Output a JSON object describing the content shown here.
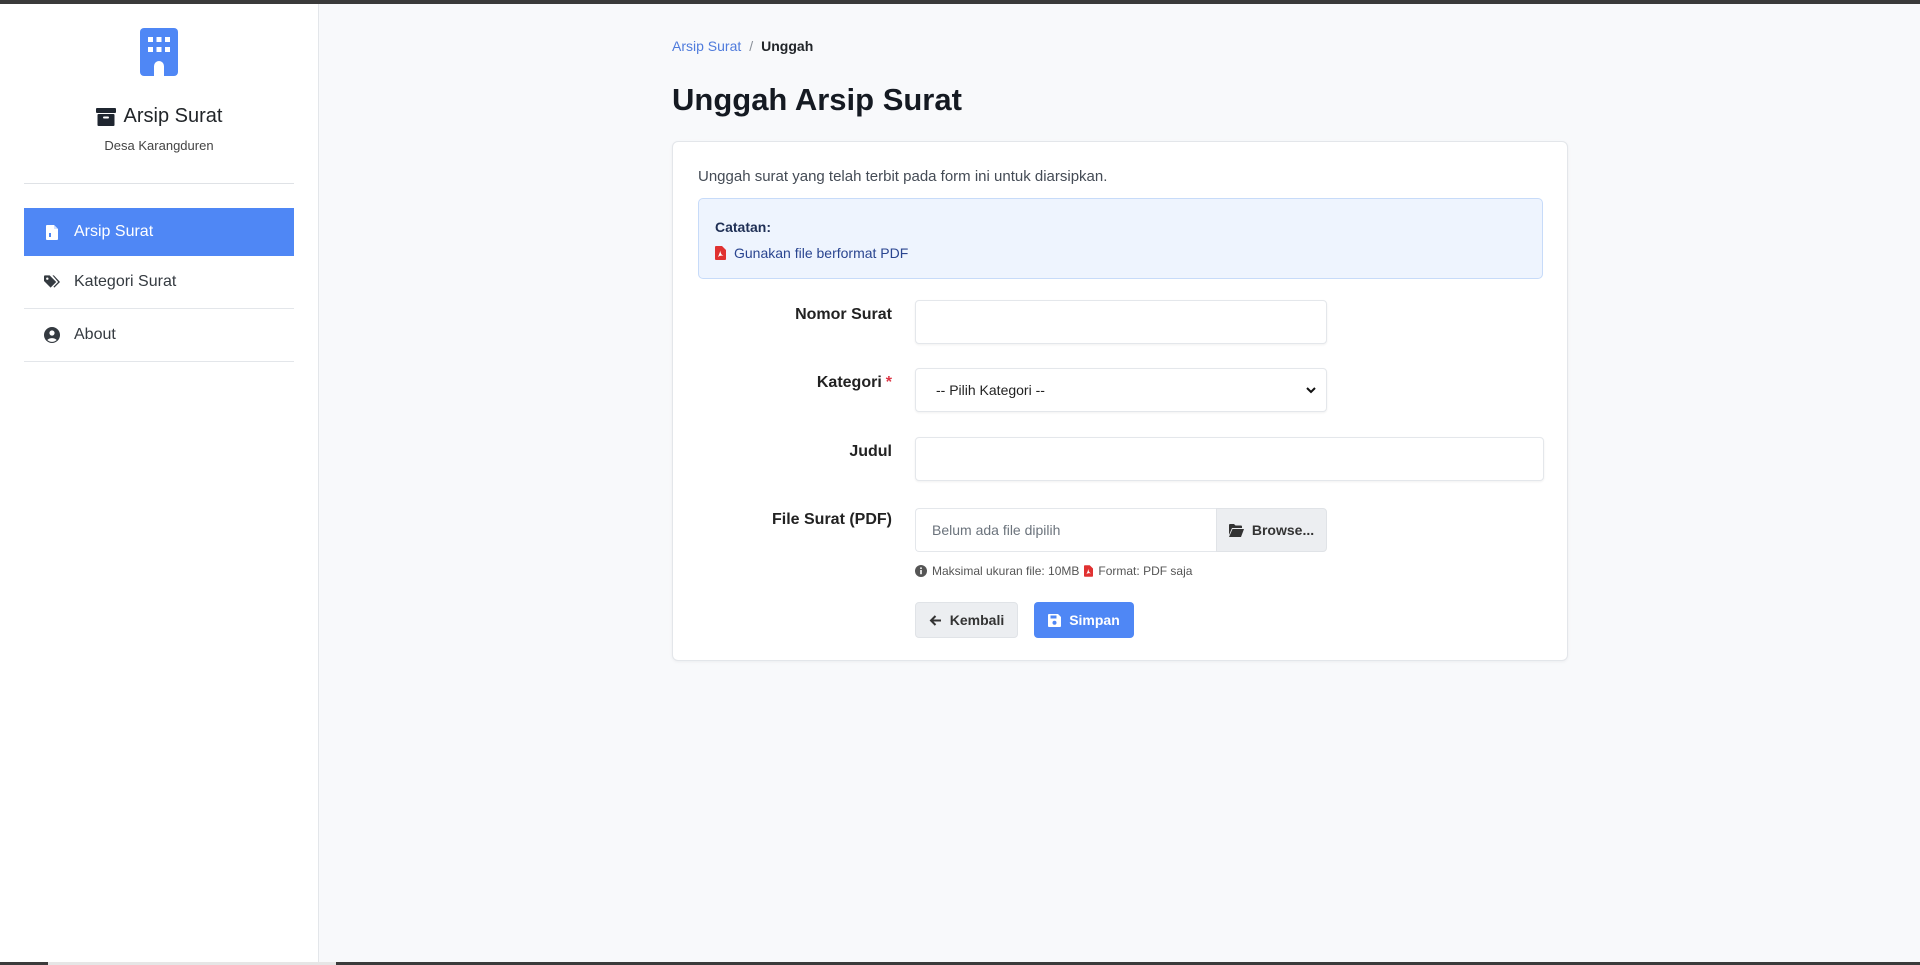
{
  "sidebar": {
    "brand_title": "Arsip Surat",
    "brand_subtitle": "Desa Karangduren",
    "items": [
      {
        "label": "Arsip Surat",
        "icon": "file-icon",
        "active": true
      },
      {
        "label": "Kategori Surat",
        "icon": "tags-icon",
        "active": false
      },
      {
        "label": "About",
        "icon": "user-circle-icon",
        "active": false
      }
    ]
  },
  "breadcrumb": {
    "parent": "Arsip Surat",
    "separator": "/",
    "current": "Unggah"
  },
  "page": {
    "title": "Unggah Arsip Surat"
  },
  "form": {
    "intro": "Unggah surat yang telah terbit pada form ini untuk diarsipkan.",
    "note_title": "Catatan:",
    "note_item": "Gunakan file berformat PDF",
    "fields": {
      "nomor_label": "Nomor Surat",
      "nomor_value": "",
      "kategori_label": "Kategori",
      "kategori_required": "*",
      "kategori_selected": "-- Pilih Kategori --",
      "judul_label": "Judul",
      "judul_value": "",
      "file_label": "File Surat (PDF)",
      "file_placeholder": "Belum ada file dipilih",
      "file_button": "Browse...",
      "help_size": "Maksimal ukuran file: 10MB",
      "help_format": "Format: PDF saja"
    },
    "buttons": {
      "back": "Kembali",
      "save": "Simpan"
    }
  },
  "colors": {
    "accent": "#4f87f5",
    "required": "#dc3545",
    "pdf_red": "#e03131",
    "note_bg": "#eef4fe"
  }
}
